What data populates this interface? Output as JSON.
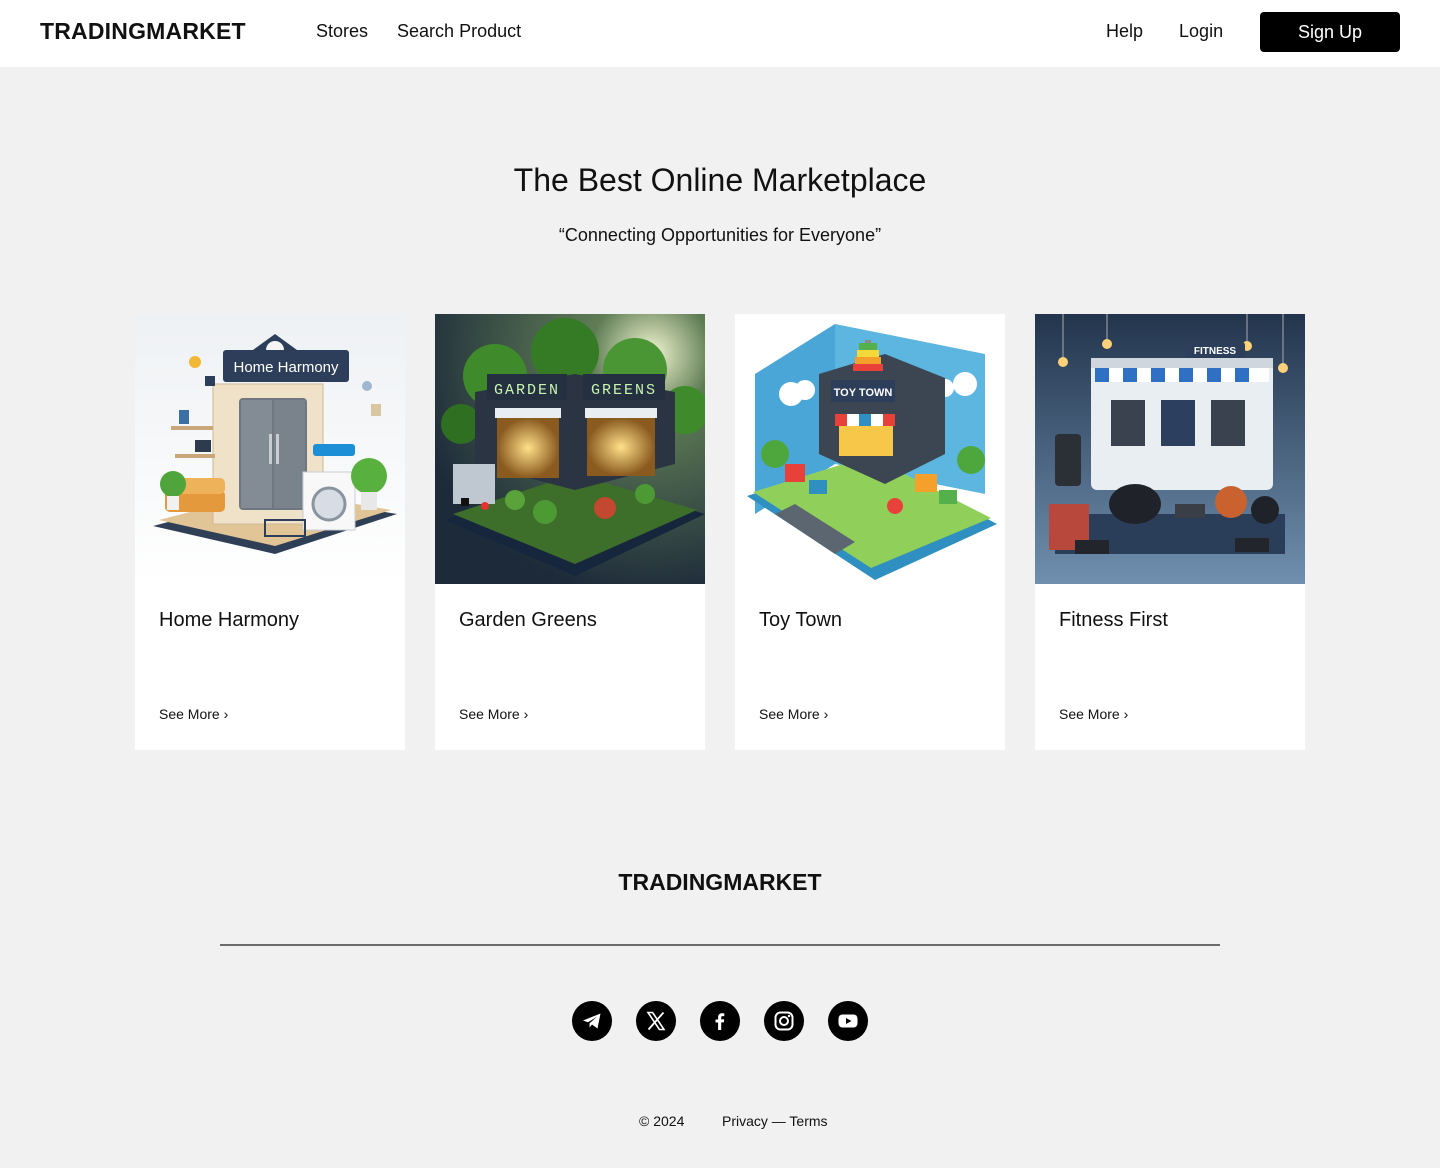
{
  "header": {
    "logo": "TRADINGMARKET",
    "nav_left": [
      "Stores",
      "Search Product"
    ],
    "help": "Help",
    "login": "Login",
    "signup": "Sign Up"
  },
  "hero": {
    "title": "The Best Online Marketplace",
    "subtitle": "“Connecting Opportunities for Everyone”"
  },
  "stores": [
    {
      "name": "Home Harmony",
      "link": "See More ›",
      "image_text": "Home Harmony"
    },
    {
      "name": "Garden Greens",
      "link": "See More ›",
      "image_text_1": "GARDEN",
      "image_text_2": "GREENS"
    },
    {
      "name": "Toy Town",
      "link": "See More ›",
      "image_text": "TOY TOWN"
    },
    {
      "name": "Fitness First",
      "link": "See More ›",
      "image_text": "FITNESS"
    }
  ],
  "footer": {
    "logo": "TRADINGMARKET",
    "socials": [
      "telegram-icon",
      "x-icon",
      "facebook-icon",
      "instagram-icon",
      "youtube-icon"
    ],
    "copyright": "© 2024",
    "legal": "Privacy — Terms"
  },
  "colors": {
    "page_bg": "#f1f1f1",
    "header_bg": "#ffffff",
    "button_bg": "#000000",
    "button_text": "#ffffff",
    "rule": "#6b6b6b"
  }
}
